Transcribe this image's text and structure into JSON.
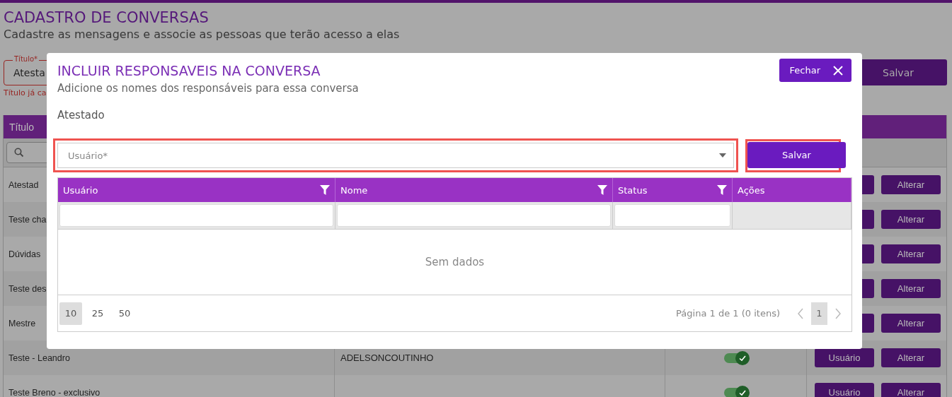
{
  "page": {
    "title": "CADASTRO DE CONVERSAS",
    "subtitle": "Cadastre as mensagens e associe as pessoas que terão acesso a elas"
  },
  "form": {
    "title_field": {
      "label": "Título*",
      "value": "Atesta",
      "invalid": true
    },
    "error": "Título já ca",
    "save_button": "Salvar"
  },
  "table": {
    "columns": [
      "Título"
    ],
    "rows": [
      {
        "title": "Atestad",
        "actions": [
          "Alterar"
        ]
      },
      {
        "title": "Teste cha",
        "actions": [
          "Alterar"
        ]
      },
      {
        "title": "Dúvidas",
        "actions": [
          "Alterar"
        ]
      },
      {
        "title": "Teste des",
        "actions": [
          "Alterar"
        ]
      },
      {
        "title": "Mestre",
        "actions": [
          "Alterar"
        ]
      },
      {
        "title": "Teste - Leandro",
        "name": "ADELSONCOUTINHO",
        "active": true,
        "actions": [
          "Usuário",
          "Alterar"
        ]
      },
      {
        "title": "Teste Breno - exclusivo",
        "active": true,
        "actions": [
          "Usuário",
          "Alterar"
        ]
      }
    ]
  },
  "dialog": {
    "title": "INCLUIR RESPONSAVEIS NA CONVERSA",
    "subtitle": "Adicione os nomes dos responsáveis para essa conversa",
    "conversation": "Atestado",
    "close_button": "Fechar",
    "user_select": {
      "placeholder": "Usuário*",
      "highlighted": true
    },
    "save_button": {
      "label": "Salvar",
      "highlighted": true
    },
    "grid": {
      "columns": [
        {
          "label": "Usuário",
          "filter": true
        },
        {
          "label": "Nome",
          "filter": true
        },
        {
          "label": "Status",
          "filter": true
        },
        {
          "label": "Ações",
          "filter": false
        }
      ],
      "empty_text": "Sem dados",
      "page_sizes": [
        {
          "label": "10",
          "selected": true
        },
        {
          "label": "25",
          "selected": false
        },
        {
          "label": "50",
          "selected": false
        }
      ],
      "page_info": "Página 1 de 1 (0 itens)",
      "pages": [
        {
          "label": "1",
          "selected": true
        }
      ]
    }
  }
}
